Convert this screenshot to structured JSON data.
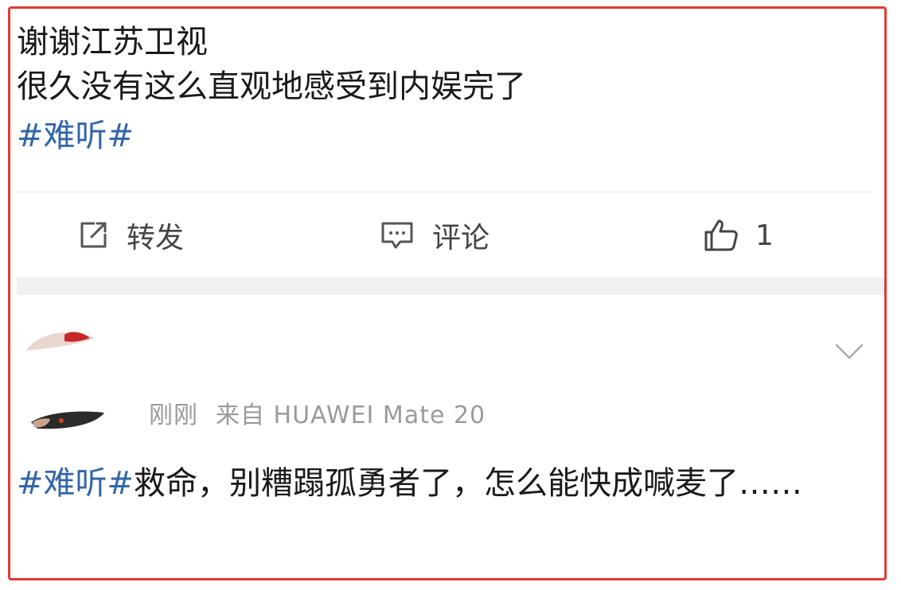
{
  "post": {
    "line1": "谢谢江苏卫视",
    "line2": "很久没有这么直观地感受到内娱完了",
    "hashtag": "#难听#"
  },
  "actions": {
    "share_label": "转发",
    "comment_label": "评论",
    "like_count": "1"
  },
  "reply": {
    "time": "刚刚",
    "source": "来自 HUAWEI Mate 20",
    "hashtag": "#难听#",
    "text": "救命，别糟蹋孤勇者了，怎么能快成喊麦了……"
  },
  "colors": {
    "border": "#e53935",
    "hashtag": "#3366a8",
    "text": "#1a1a1a",
    "meta": "#9a9a9a",
    "band": "#f1f1f3"
  },
  "icons": {
    "share": "share-icon",
    "comment": "comment-icon",
    "like": "thumbs-up-icon",
    "expand": "chevron-down-icon"
  }
}
